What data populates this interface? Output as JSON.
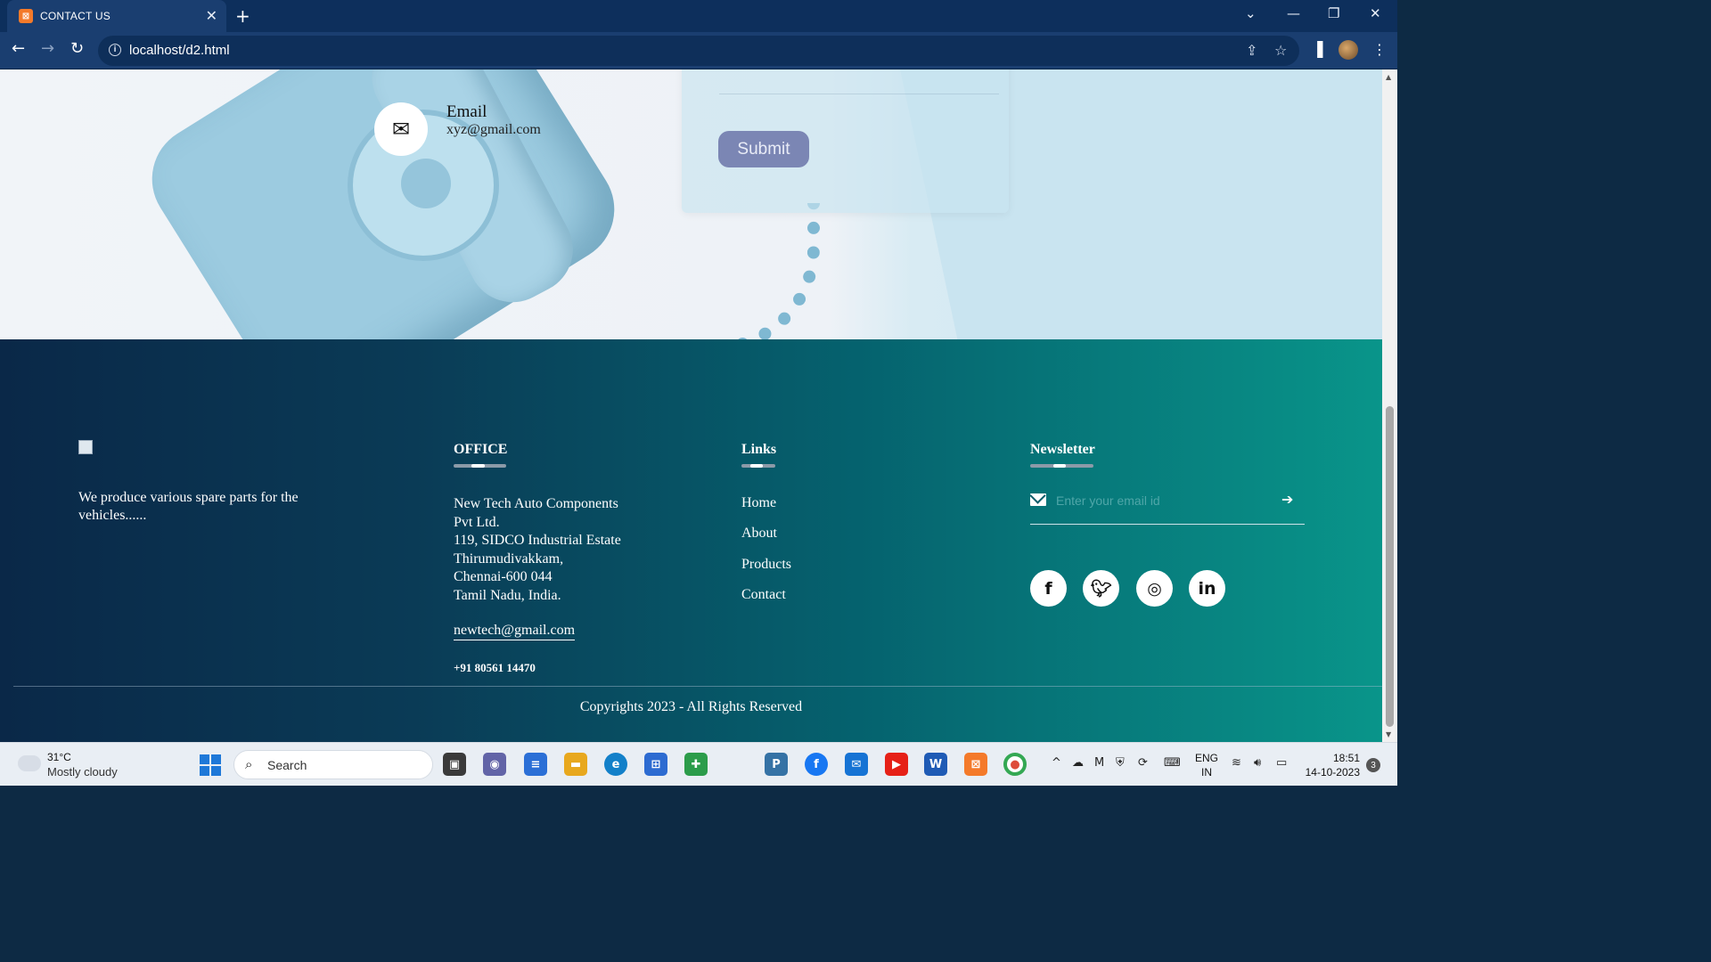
{
  "browser": {
    "tab_title": "CONTACT US",
    "tab_close": "✕",
    "new_tab": "+",
    "url": "localhost/d2.html"
  },
  "hero": {
    "email_title": "Email",
    "email_value": "xyz@gmail.com",
    "submit_label": "Submit"
  },
  "footer": {
    "about_text": "We produce various spare parts for the vehicles......",
    "office": {
      "title": "OFFICE",
      "address_lines": [
        "New Tech Auto Components",
        "Pvt Ltd.",
        "119, SIDCO Industrial Estate",
        "Thirumudivakkam,",
        "Chennai-600 044",
        "Tamil Nadu, India."
      ],
      "email": "newtech@gmail.com",
      "phone": "+91 80561 14470"
    },
    "links": {
      "title": "Links",
      "items": [
        "Home",
        "About",
        "Products",
        "Contact"
      ]
    },
    "newsletter": {
      "title": "Newsletter",
      "placeholder": "Enter your email id"
    },
    "social": [
      "facebook-icon",
      "twitter-icon",
      "instagram-icon",
      "linkedin-icon"
    ],
    "copyright": "Copyrights 2023 - All Rights Reserved"
  },
  "taskbar": {
    "weather_temp": "31°C",
    "weather_desc": "Mostly cloudy",
    "search_label": "Search",
    "lang_top": "ENG",
    "lang_bottom": "IN",
    "time": "18:51",
    "date": "14-10-2023",
    "notification_count": "3"
  },
  "colors": {
    "footer_start": "#0a2848",
    "footer_end": "#09958a",
    "submit": "#7b86b4",
    "browser_frame": "#0d2f5c"
  }
}
